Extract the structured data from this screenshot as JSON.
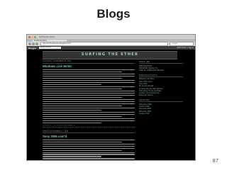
{
  "slide": {
    "title": "Blogs",
    "number": "87"
  },
  "browser": {
    "window_title": "Surfing the Ether",
    "tab_label": "Surfing the Ether",
    "url": "http://surfingtheether.blogspot.com/",
    "search_placeholder": "Google"
  },
  "blogger_bar": {
    "logo": "Blogger",
    "search_label": "SEARCH BLOG",
    "links": "NEXT BLOG »  Sign in"
  },
  "blog": {
    "title": "SURFING THE ETHER",
    "posts": [
      {
        "date": "SATURDAY, NOVEMBER 25, 2006",
        "title": "Windows Live Writer",
        "footer": "POSTED BY ... AT 10:28 AM   0 COMMENTS"
      },
      {
        "date": "FRIDAY, NOVEMBER 17, 2006",
        "title": "Sony 2006 cont'd",
        "footer": ""
      }
    ],
    "sidebar": {
      "about_heading": "ABOUT ME",
      "about_lines": [
        "SAM HOUSTON",
        "HOUSTON, TEXAS, US",
        "VIEW MY COMPLETE PROFILE"
      ],
      "previous_heading": "PREVIOUS POSTS",
      "previous_links": [
        "Windows Live Writer",
        "Sony 2006 cont'd",
        "Sony 2006",
        "My speech did well",
        "Cruising after the Lake Sailboat",
        "Podcasting, iTunes and Wikis",
        "Another new Teaching Tool",
        "Before the Internet"
      ],
      "archives_heading": "ARCHIVES",
      "archive_links": [
        "September 2006",
        "October 2006",
        "November 2006",
        "December 2006",
        "January 2007"
      ]
    }
  }
}
